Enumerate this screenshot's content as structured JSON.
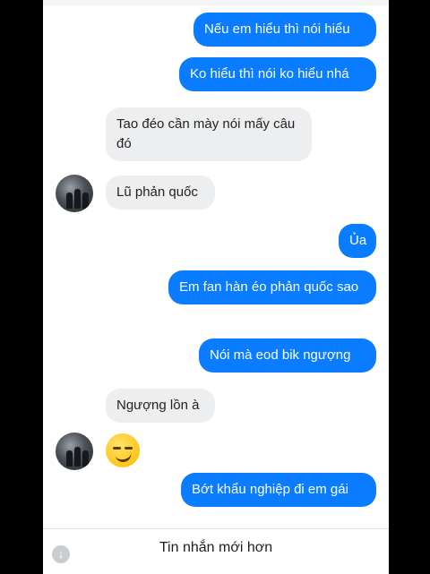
{
  "messages": [
    {
      "side": "out",
      "text": "Nếu em hiểu thì nói hiểu"
    },
    {
      "side": "out",
      "text": "Ko hiểu thì nói ko hiểu nhá"
    },
    {
      "side": "in",
      "text": "Tao đéo cần mày nói mấy câu đó"
    },
    {
      "side": "in",
      "text": "Lũ phản quốc"
    },
    {
      "side": "out",
      "text": "Ủa"
    },
    {
      "side": "out",
      "text": "Em fan hàn éo phản quốc sao"
    },
    {
      "side": "out",
      "text": "Nói mà eod bik ngượng"
    },
    {
      "side": "in",
      "text": "Ngượng lồn à"
    },
    {
      "side": "in",
      "emoji": "smirk-emoji"
    },
    {
      "side": "out",
      "text": "Bớt khẩu nghiệp đi em gái"
    }
  ],
  "footer": {
    "label": "Tin nhắn mới hơn",
    "icon": "arrow-down-icon"
  },
  "colors": {
    "outgoing": "#0a7cff",
    "incoming": "#edeef0",
    "frame": "#000000"
  }
}
